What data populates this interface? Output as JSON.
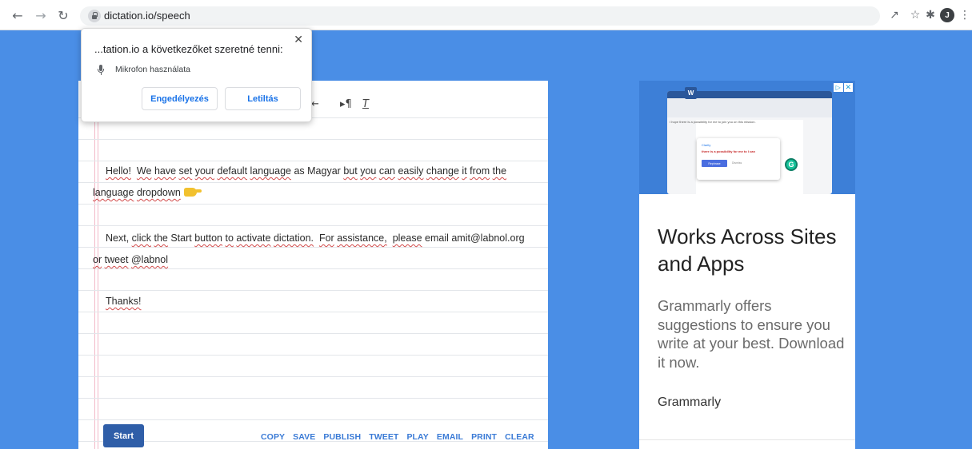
{
  "browser": {
    "url": "dictation.io/speech",
    "avatar_initial": "J"
  },
  "editor": {
    "lines": {
      "l1": {
        "w1": "Hello!",
        "w2": "We",
        "w3": "have",
        "w4": "set",
        "w5": "your",
        "w6": "default",
        "w7": "language",
        "w8": "as  Magyar",
        "w9": "but",
        "w10": "you",
        "w11": "can",
        "w12": "easily",
        "w13": "change",
        "w14": "it",
        "w15": "from",
        "w16": "the"
      },
      "l2": {
        "w1": "language",
        "w2": "dropdown"
      },
      "l3": {
        "w1": "Next,",
        "w2": "click",
        "w3": "the",
        "w4": "Start",
        "w5": "button",
        "w6": "to",
        "w7": "activate",
        "w8": "dictation.",
        "w9": "For",
        "w10": "assistance,",
        "w11": "please",
        "w12": "email amit@labnol.org"
      },
      "l4": {
        "w1": "or",
        "w2": "tweet",
        "w3": "@labnol"
      },
      "l5": {
        "w1": "Thanks!"
      }
    },
    "start_label": "Start",
    "actions": {
      "copy": "COPY",
      "save": "SAVE",
      "publish": "PUBLISH",
      "tweet": "TWEET",
      "play": "PLAY",
      "email": "EMAIL",
      "print": "PRINT",
      "clear": "CLEAR"
    }
  },
  "permission_popup": {
    "title": "...tation.io a következőket szeretné tenni:",
    "permission": "Mikrofon használata",
    "allow_label": "Engedélyezés",
    "block_label": "Letiltás"
  },
  "ad": {
    "headline": "Works Across Sites and Apps",
    "body": "Grammarly offers suggestions to ensure you write at your best. Download it now.",
    "brand": "Grammarly",
    "image": {
      "doc_text": "I hope there is a possibility for me to join you on this mission.",
      "card_label": "Clarity",
      "card_text": "there is a possibility for me to I can",
      "card_button": "Rephrase",
      "card_dismiss": "Dismiss"
    }
  }
}
